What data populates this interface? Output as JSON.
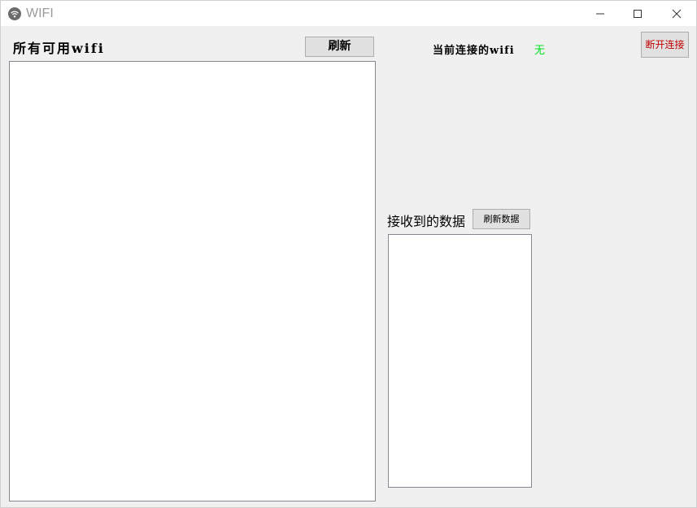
{
  "window": {
    "title": "WIFI",
    "icon": "wifi-icon",
    "controls": {
      "minimize": "minimize-icon",
      "maximize": "maximize-icon",
      "close": "close-icon"
    }
  },
  "left_panel": {
    "title": "所有可用wifi",
    "refresh_label": "刷新",
    "wifi_list": []
  },
  "connection": {
    "label": "当前连接的wifi",
    "value": "无",
    "value_color": "#00e020",
    "disconnect_label": "断开连接",
    "disconnect_color": "#c00000"
  },
  "received": {
    "label": "接收到的数据",
    "refresh_label": "刷新数据",
    "data_list": []
  }
}
